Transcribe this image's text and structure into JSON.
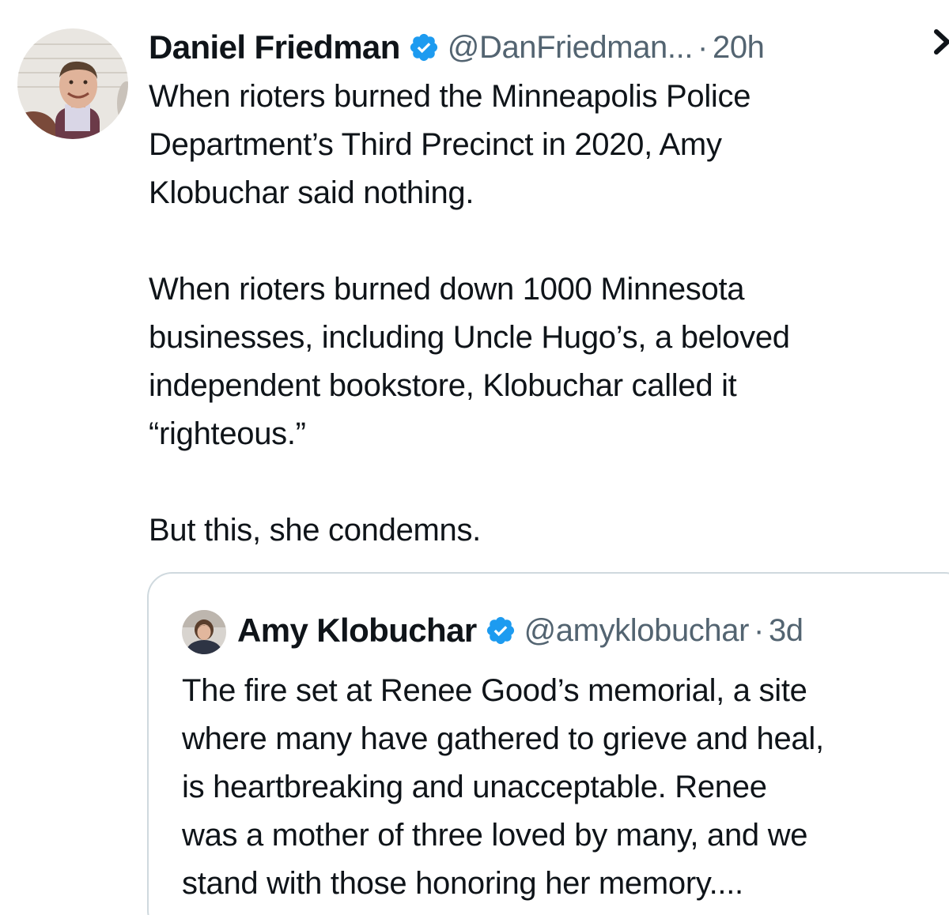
{
  "tweet": {
    "author_name": "Daniel Friedman",
    "handle": "@DanFriedman...",
    "separator": "·",
    "time": "20h",
    "paragraphs": [
      "When rioters burned the Minneapolis Police\nDepartment’s Third Precinct in 2020, Amy\nKlobuchar said nothing.",
      "When rioters burned down 1000 Minnesota\nbusinesses, including Uncle Hugo’s, a beloved\nindependent bookstore, Klobuchar called it\n“righteous.”",
      "But this, she condemns."
    ],
    "verified_icon": "verified-badge-icon",
    "more_icon": "chevron-right-icon"
  },
  "quoted_tweet": {
    "author_name": "Amy Klobuchar",
    "handle": "@amyklobuchar",
    "separator": "·",
    "time": "3d",
    "text": "The fire set at Renee Good’s memorial, a site\nwhere many have gathered to grieve and heal,\nis heartbreaking and unacceptable. Renee\nwas a mother of three loved by many, and we\nstand with those honoring her memory....",
    "verified_icon": "verified-badge-icon"
  },
  "colors": {
    "text": "#0f1419",
    "secondary": "#536471",
    "verified": "#1d9bf0",
    "border": "#cfd9de"
  }
}
